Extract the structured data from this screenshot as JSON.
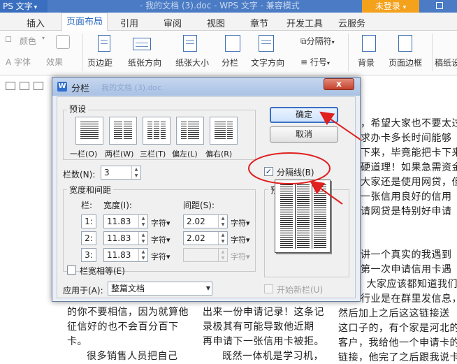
{
  "titlebar": {
    "app_button": "PS 文字",
    "doc_title": "- 我的文档 (3).doc - WPS 文字 - 兼容模式",
    "login_button": "未登录"
  },
  "menu": {
    "tabs": [
      "插入",
      "页面布局",
      "引用",
      "审阅",
      "视图",
      "章节",
      "开发工具",
      "云服务"
    ],
    "active_tab": "页面布局"
  },
  "ribbon": {
    "color_label": "颜色",
    "font_label": "字体",
    "effect_label": "效果",
    "margins": "页边距",
    "orientation": "纸张方向",
    "size": "纸张大小",
    "columns": "分栏",
    "text_direction": "文字方向",
    "line_numbers": "行号",
    "separator_label": "分隔符",
    "background": "背景",
    "page_border": "页面边框",
    "draft": "稿纸设"
  },
  "document": {
    "right_lines": [
      "，希望大家也不要太过",
      "求办卡多长时间能够",
      "下来，毕竟能把卡下来",
      "硬道理！如果急需资金",
      "大家还是使用网贷，但",
      "一张信用良好的信用",
      "请网贷是特别好申请",
      "讲一个真实的我遇到",
      "第一次申请信用卡遇",
      "，大家应该都知道我们",
      "行业是在群里发信息，",
      "然后加上之后这这链接送",
      "这口子的，有个家是河北的",
      "客户，我给他一个申请卡的",
      "链接，他完了之后跟我说卡"
    ],
    "bottom_col1": [
      "的你不要相信，因为就算他",
      "征信好的也不会百分百下",
      "卡。",
      "很多销售人员把自己"
    ],
    "bottom_col2": [
      "出来一份申请记录！这条记",
      "录极其有可能导致他近期",
      "再申请下一张信用卡被拒。",
      "既然一体机是学习机，"
    ]
  },
  "dialog": {
    "title": "分栏",
    "ghost_tab": "我的文档 (3).doc",
    "close_symbol": "x",
    "presets_title": "预设",
    "presets": [
      "一栏(O)",
      "两栏(W)",
      "三栏(T)",
      "偏左(L)",
      "偏右(R)"
    ],
    "column_count_label": "栏数(N):",
    "column_count_value": "3",
    "width_spacing_title": "宽度和间距",
    "col_header": "栏:",
    "width_header": "宽度(I):",
    "spacing_header": "间距(S):",
    "rows": [
      {
        "no": "1:",
        "width": "11.83",
        "width_unit": "字符▾",
        "spacing": "2.02",
        "spacing_unit": "字符▾"
      },
      {
        "no": "2:",
        "width": "11.83",
        "width_unit": "字符▾",
        "spacing": "2.02",
        "spacing_unit": "字符▾"
      },
      {
        "no": "3:",
        "width": "11.83",
        "width_unit": "字符▾",
        "spacing": "",
        "spacing_unit": "字符▾"
      }
    ],
    "equal_width_label": "栏宽相等(E)",
    "equal_width_checked": false,
    "ok_button": "确定",
    "cancel_button": "取消",
    "separator_checkbox": "分隔线(B)",
    "separator_checked": true,
    "preview_title": "预览",
    "apply_to_label": "应用于(A):",
    "apply_to_value": "整篇文档",
    "new_column_label": "开始新栏(U)",
    "new_column_checked": false
  },
  "colors": {
    "accent": "#2f6bc0",
    "annotation_red": "#e02020",
    "login_orange": "#f4a11c"
  }
}
